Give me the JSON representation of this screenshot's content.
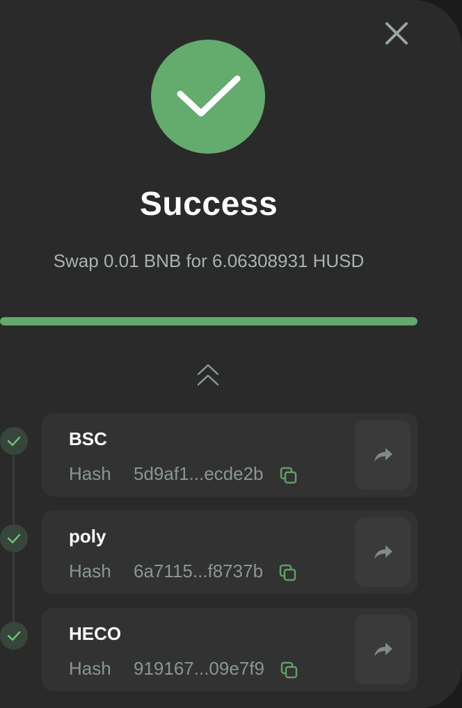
{
  "dialog": {
    "title": "Success",
    "subtitle": "Swap 0.01 BNB for 6.06308931 HUSD",
    "status_color": "#64ab6e"
  },
  "progress": {
    "percent": 100,
    "color": "#63a96c"
  },
  "icons": {
    "close": "close-icon",
    "success": "check-icon",
    "collapse": "chevron-double-up-icon",
    "copy": "copy-icon",
    "share": "share-arrow-icon"
  },
  "chains": [
    {
      "name": "BSC",
      "hash_label": "Hash",
      "hash": "5d9af1...ecde2b",
      "status": "done"
    },
    {
      "name": "poly",
      "hash_label": "Hash",
      "hash": "6a7115...f8737b",
      "status": "done"
    },
    {
      "name": "HECO",
      "hash_label": "Hash",
      "hash": "919167...09e7f9",
      "status": "done"
    }
  ]
}
